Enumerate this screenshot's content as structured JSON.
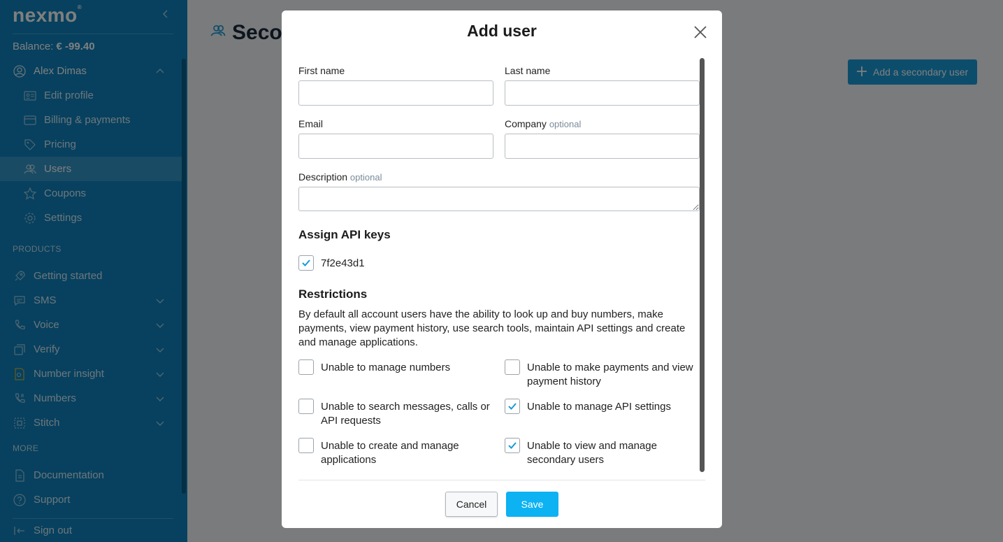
{
  "sidebar": {
    "logo": "nexmo",
    "balance_label": "Balance:",
    "balance_value": "€ -99.40",
    "account_name": "Alex Dimas",
    "account_items": [
      {
        "label": "Edit profile",
        "icon": "id-card-icon"
      },
      {
        "label": "Billing & payments",
        "icon": "credit-card-icon"
      },
      {
        "label": "Pricing",
        "icon": "tag-icon"
      },
      {
        "label": "Users",
        "icon": "users-icon",
        "active": true
      },
      {
        "label": "Coupons",
        "icon": "star-icon"
      },
      {
        "label": "Settings",
        "icon": "gear-icon"
      }
    ],
    "products_heading": "PRODUCTS",
    "product_items": [
      {
        "label": "Getting started",
        "icon": "rocket-icon"
      },
      {
        "label": "SMS",
        "icon": "chat-icon"
      },
      {
        "label": "Voice",
        "icon": "phone-icon"
      },
      {
        "label": "Verify",
        "icon": "verify-icon"
      },
      {
        "label": "Number insight",
        "icon": "insight-icon"
      },
      {
        "label": "Numbers",
        "icon": "numbers-icon"
      },
      {
        "label": "Stitch",
        "icon": "stitch-icon"
      }
    ],
    "more_heading": "MORE",
    "more_items": [
      {
        "label": "Documentation",
        "icon": "document-icon"
      },
      {
        "label": "Support",
        "icon": "help-icon"
      }
    ],
    "sign_out": "Sign out"
  },
  "main": {
    "title": "Secon",
    "add_button": "Add a secondary user"
  },
  "modal": {
    "title": "Add user",
    "first_name_label": "First name",
    "last_name_label": "Last name",
    "email_label": "Email",
    "company_label": "Company",
    "optional_tag": "optional",
    "description_label": "Description",
    "first_name_value": "",
    "last_name_value": "",
    "email_value": "",
    "company_value": "",
    "description_value": "",
    "api_keys_title": "Assign API keys",
    "api_key": {
      "label": "7f2e43d1",
      "checked": true
    },
    "restrictions_title": "Restrictions",
    "restrictions_text": "By default all account users have the ability to look up and buy numbers, make payments, view payment history, use search tools, maintain API settings and create and manage applications.",
    "restrictions": [
      {
        "label": "Unable to manage numbers",
        "checked": false
      },
      {
        "label": "Unable to make payments and view payment history",
        "checked": false
      },
      {
        "label": "Unable to search messages, calls or API requests",
        "checked": false
      },
      {
        "label": "Unable to manage API settings",
        "checked": true
      },
      {
        "label": "Unable to create and manage applications",
        "checked": false
      },
      {
        "label": "Unable to view and manage secondary users",
        "checked": true
      }
    ],
    "cancel_label": "Cancel",
    "save_label": "Save"
  },
  "colors": {
    "sidebar": "#0e83bf",
    "primary_button": "#0db2f2",
    "check": "#1b9ad8"
  }
}
